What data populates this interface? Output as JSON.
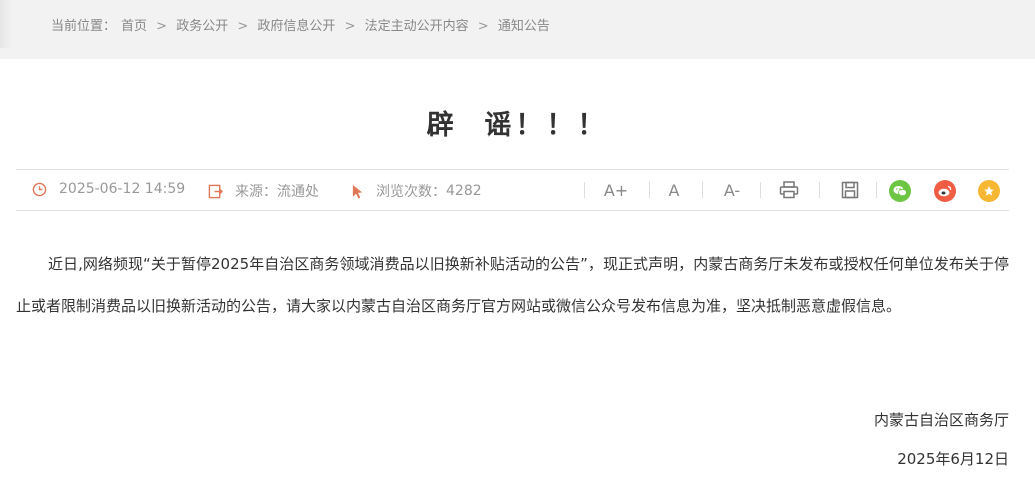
{
  "breadcrumb": {
    "label": "当前位置：",
    "items": [
      "首页",
      "政务公开",
      "政府信息公开",
      "法定主动公开内容",
      "通知公告"
    ],
    "separator": ">"
  },
  "article": {
    "title": "辟  谣！！！",
    "meta": {
      "date": "2025-06-12 14:59",
      "source": "来源：流通处",
      "views_label": "浏览次数：",
      "views": "4282"
    },
    "tools": {
      "font_larger": "A+",
      "font_normal": "A",
      "font_smaller": "A-"
    },
    "body": "近日,网络频现“关于暂停2025年自治区商务领域消费品以旧换新补贴活动的公告”，现正式声明，内蒙古商务厅未发布或授权任何单位发布关于停止或者限制消费品以旧换新活动的公告，请大家以内蒙古自治区商务厅官方网站或微信公众号发布信息为准，坚决抵制恶意虚假信息。",
    "signature": "内蒙古自治区商务厅",
    "signature_date": "2025年6月12日"
  },
  "colors": {
    "accent": "#e0785a",
    "wechat": "#6cc644",
    "weibo": "#f05d45",
    "favorite": "#f7b733"
  },
  "icons": [
    "clock-icon",
    "source-icon",
    "cursor-icon",
    "print-icon",
    "save-icon",
    "wechat-icon",
    "weibo-icon",
    "star-icon"
  ]
}
